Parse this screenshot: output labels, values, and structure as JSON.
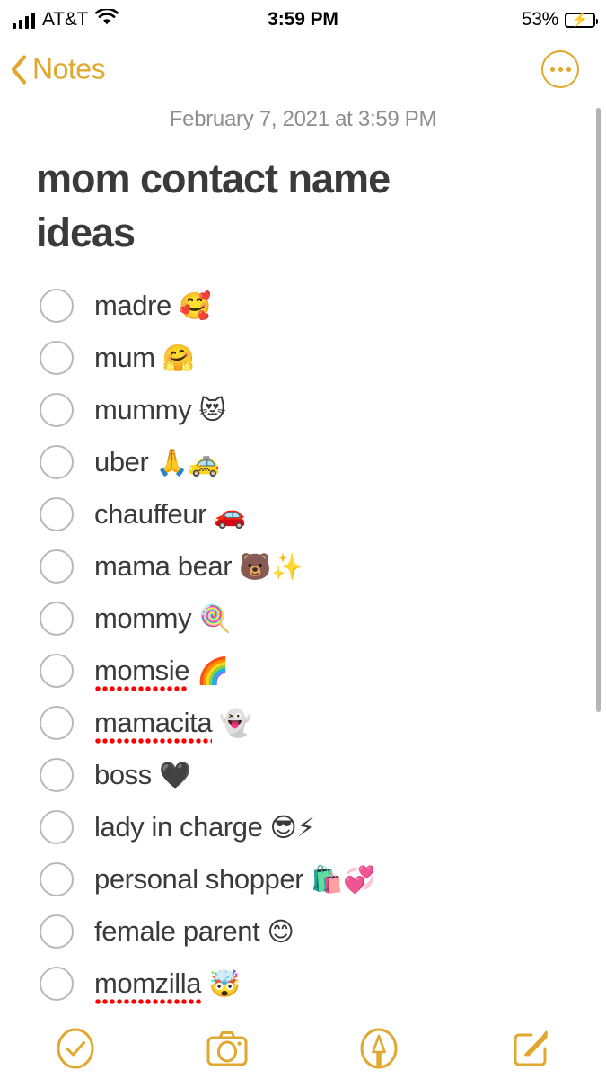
{
  "status_bar": {
    "carrier": "AT&T",
    "signal_icon": "cellular-signal-icon",
    "wifi_icon": "wifi-icon",
    "time": "3:59 PM",
    "battery_percent": "53%",
    "battery_icon": "battery-charging-icon",
    "battery_level": 53
  },
  "nav": {
    "back_label": "Notes",
    "back_icon": "chevron-left-icon",
    "more_icon": "ellipsis-circle-icon",
    "accent_color": "#E0A82E"
  },
  "note": {
    "date": "February 7, 2021 at 3:59 PM",
    "title": "mom contact name ideas",
    "items": [
      {
        "text": "madre",
        "emoji": "🥰",
        "checked": false,
        "misspelled": false
      },
      {
        "text": "mum",
        "emoji": "🤗",
        "checked": false,
        "misspelled": false
      },
      {
        "text": "mummy",
        "emoji": "😻",
        "checked": false,
        "misspelled": false
      },
      {
        "text": "uber",
        "emoji": "🙏🚕",
        "checked": false,
        "misspelled": false
      },
      {
        "text": "chauffeur",
        "emoji": "🚗",
        "checked": false,
        "misspelled": false
      },
      {
        "text": "mama bear",
        "emoji": "🐻✨",
        "checked": false,
        "misspelled": false
      },
      {
        "text": "mommy",
        "emoji": "🍭",
        "checked": false,
        "misspelled": false
      },
      {
        "text": "momsie",
        "emoji": "🌈",
        "checked": false,
        "misspelled": true
      },
      {
        "text": "mamacita",
        "emoji": "👻",
        "checked": false,
        "misspelled": true
      },
      {
        "text": "boss",
        "emoji": "🖤",
        "checked": false,
        "misspelled": false
      },
      {
        "text": "lady in charge",
        "emoji": "😎⚡",
        "checked": false,
        "misspelled": false
      },
      {
        "text": "personal shopper",
        "emoji": "🛍️💞",
        "checked": false,
        "misspelled": false
      },
      {
        "text": "female parent",
        "emoji": "😊",
        "checked": false,
        "misspelled": false
      },
      {
        "text": "momzilla",
        "emoji": "🤯",
        "checked": false,
        "misspelled": true
      }
    ]
  },
  "toolbar": {
    "items": [
      {
        "icon": "checklist-circle-icon",
        "label": "Checklist"
      },
      {
        "icon": "camera-icon",
        "label": "Camera"
      },
      {
        "icon": "markup-pen-circle-icon",
        "label": "Markup"
      },
      {
        "icon": "compose-icon",
        "label": "Compose"
      }
    ]
  },
  "colors": {
    "accent": "#E0A82E",
    "text": "#3A3A3C",
    "secondary_text": "#8E8E93",
    "checkbox_border": "#B8B8BD",
    "spellcheck_underline": "#FF0000",
    "background": "#FFFFFF"
  }
}
